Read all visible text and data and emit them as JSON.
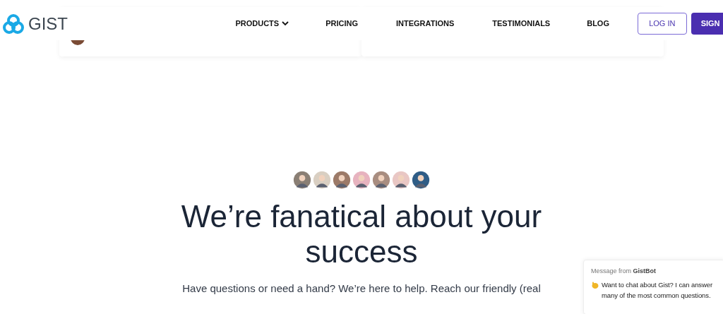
{
  "header": {
    "logo_text": "GIST",
    "nav": [
      {
        "label": "PRODUCTS",
        "dropdown": true
      },
      {
        "label": "PRICING",
        "dropdown": false
      },
      {
        "label": "INTEGRATIONS",
        "dropdown": false
      },
      {
        "label": "TESTIMONIALS",
        "dropdown": false
      },
      {
        "label": "BLOG",
        "dropdown": false
      }
    ],
    "login": "LOG IN",
    "signup": "SIGN"
  },
  "hero": {
    "avatars": [
      {
        "color": "#8a7f74"
      },
      {
        "color": "#d9cfc2"
      },
      {
        "color": "#9c7a68"
      },
      {
        "color": "#e7b3bf"
      },
      {
        "color": "#a88d80"
      },
      {
        "color": "#e9c7c4"
      },
      {
        "color": "#2f5d86"
      }
    ],
    "title_lines": [
      "We’re fanatical about your",
      "success"
    ],
    "text": "Have questions or need a hand? We’re here to help. Reach our friendly (real"
  },
  "chat": {
    "from_label": "Message from",
    "from_name": "GistBot",
    "message": "Want to chat about Gist? I can answer many of the most common questions."
  }
}
